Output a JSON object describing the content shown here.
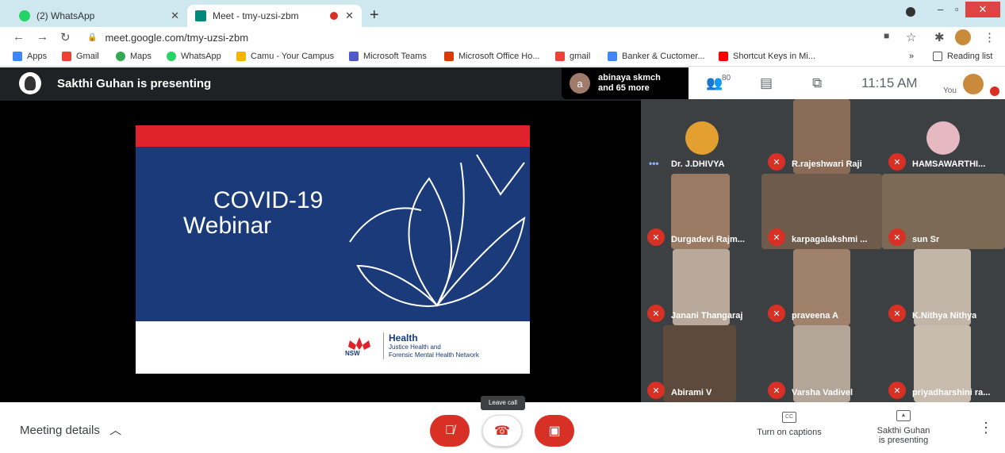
{
  "browser": {
    "tabs": [
      {
        "label": "(2) WhatsApp",
        "active": false
      },
      {
        "label": "Meet - tmy-uzsi-zbm",
        "active": true
      }
    ],
    "new_tab": "+",
    "url": "meet.google.com/tmy-uzsi-zbm",
    "bookmarks": [
      {
        "label": "Apps"
      },
      {
        "label": "Gmail"
      },
      {
        "label": "Maps"
      },
      {
        "label": "WhatsApp"
      },
      {
        "label": "Camu - Your Campus"
      },
      {
        "label": "Microsoft Teams"
      },
      {
        "label": "Microsoft Office Ho..."
      },
      {
        "label": "gmail"
      },
      {
        "label": "Banker & Cuctomer..."
      },
      {
        "label": "Shortcut Keys in Mi..."
      }
    ],
    "reading_list": "Reading list",
    "more_bookmarks": "»"
  },
  "meet": {
    "presenter_banner": "Sakthi Guhan is presenting",
    "participant_summary": {
      "initial": "a",
      "line1": "abinaya skmch",
      "line2": "and 65 more"
    },
    "people_count": "80",
    "time": "11:15 AM",
    "you_label": "You",
    "slide": {
      "title_line1": "COVID-19",
      "title_line2": "Webinar",
      "logo_text": "NSW",
      "org_title": "Health",
      "org_line1": "Justice Health and",
      "org_line2": "Forensic Mental Health Network"
    },
    "participants": [
      {
        "name": "Dr. J.DHIVYA",
        "muted": false
      },
      {
        "name": "R.rajeshwari Raji",
        "muted": true
      },
      {
        "name": "HAMSAWARTHI...",
        "muted": true
      },
      {
        "name": "Durgadevi Rajm...",
        "muted": true
      },
      {
        "name": "karpagalakshmi ...",
        "muted": true
      },
      {
        "name": "sun Sr",
        "muted": true
      },
      {
        "name": "Janani Thangaraj",
        "muted": true
      },
      {
        "name": "praveena A",
        "muted": true
      },
      {
        "name": "K.Nithya Nithya",
        "muted": true
      },
      {
        "name": "Abirami V",
        "muted": true
      },
      {
        "name": "Varsha Vadivel",
        "muted": true
      },
      {
        "name": "priyadharshini ra...",
        "muted": true
      }
    ]
  },
  "bottom_bar": {
    "meeting_details": "Meeting details",
    "leave_tooltip": "Leave call",
    "captions": "Turn on captions",
    "captions_icon": "CC",
    "present_line1": "Sakthi Guhan",
    "present_line2": "is presenting"
  },
  "colors": {
    "meet_bg": "#202124",
    "red": "#d93025",
    "slide_blue": "#1a3a7a",
    "slide_red": "#e0222c"
  }
}
